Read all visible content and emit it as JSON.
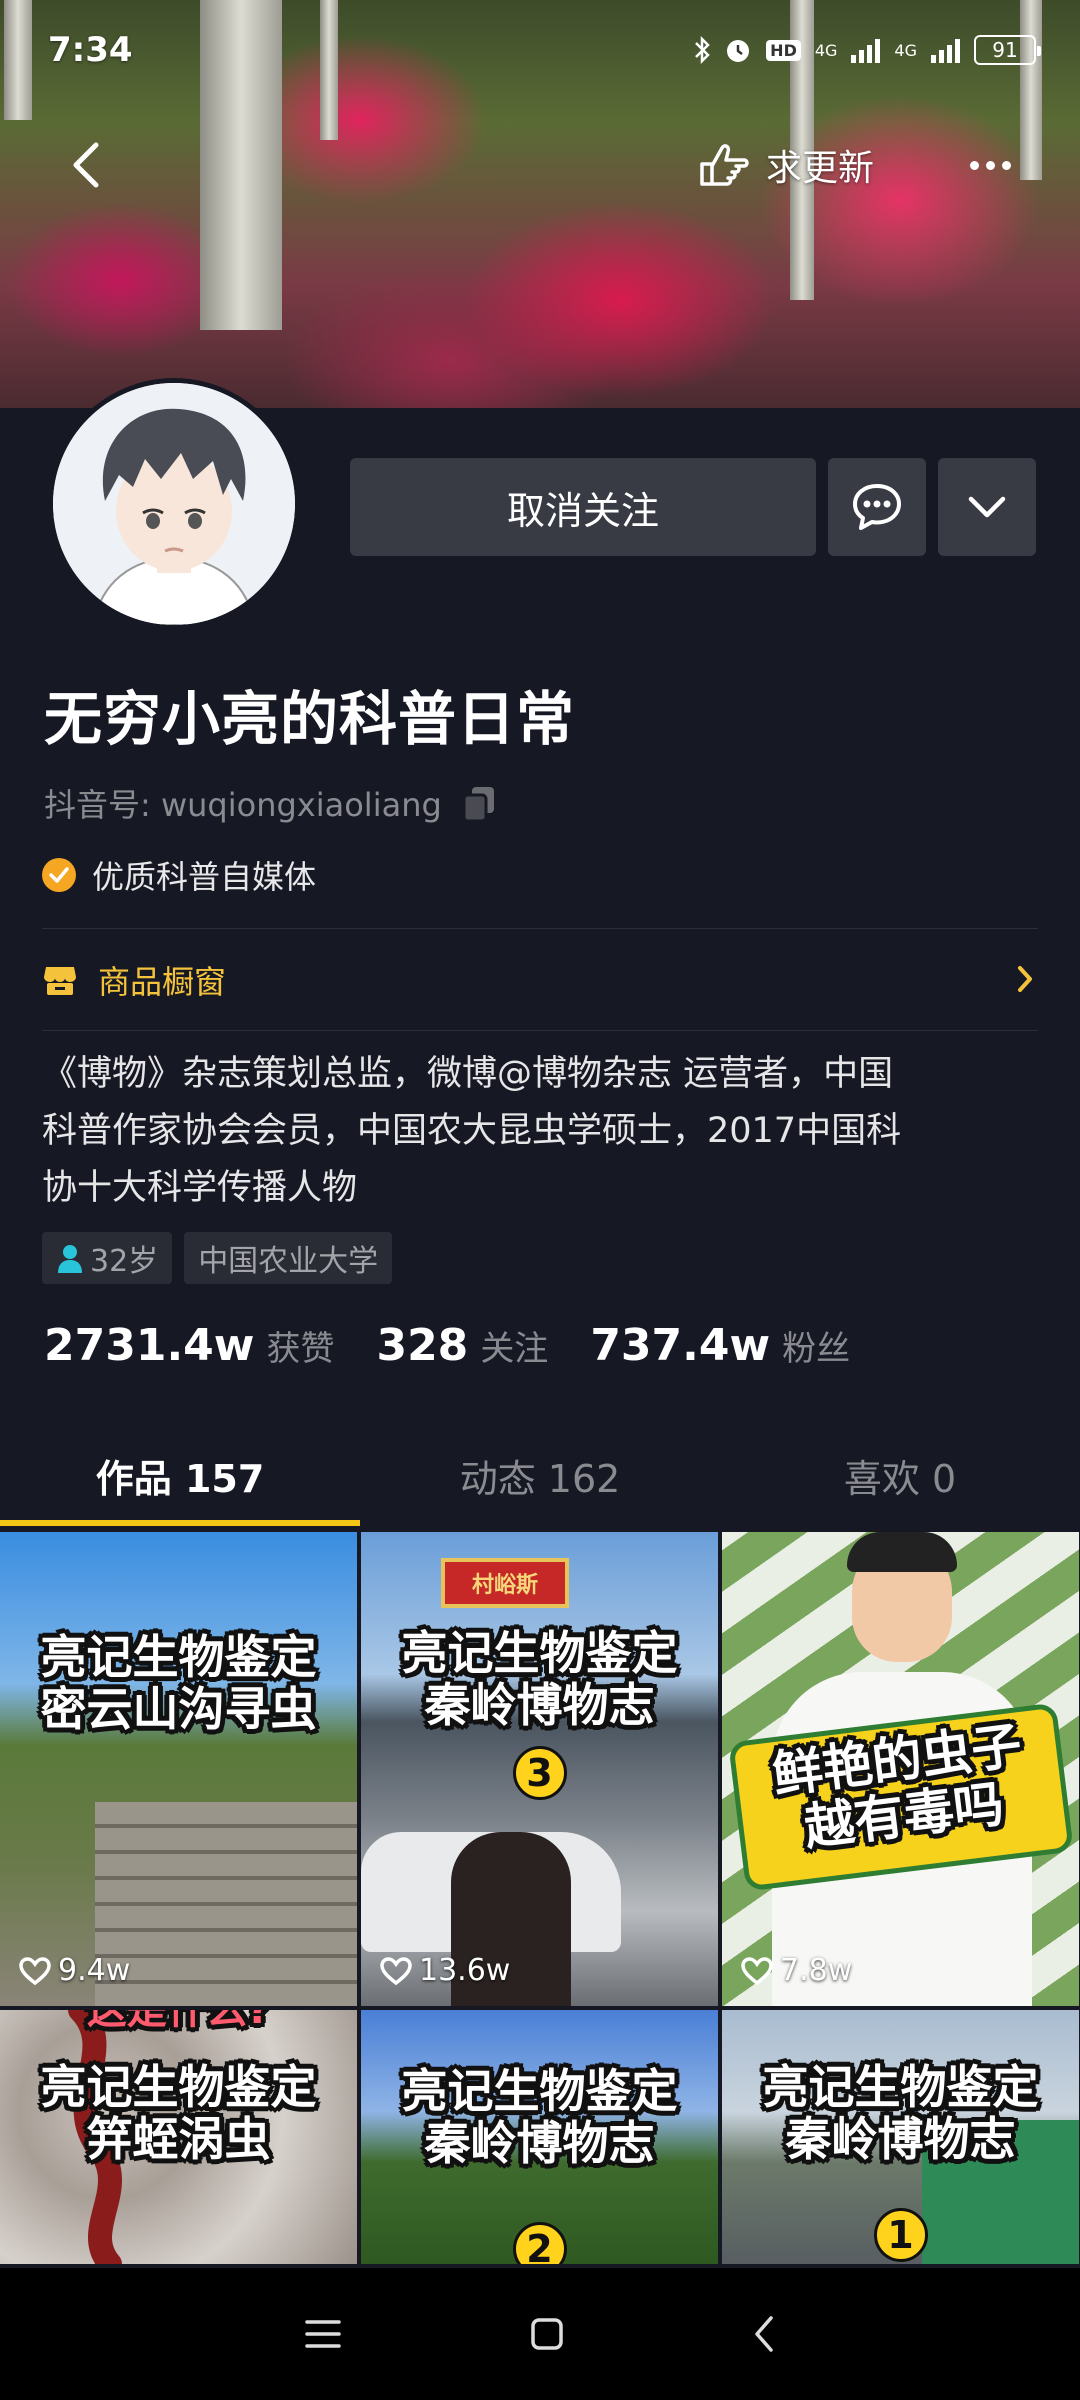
{
  "status_bar": {
    "time": "7:34",
    "battery": "91",
    "net1": "4G",
    "net2": "4G",
    "hd": "HD"
  },
  "top_nav": {
    "update_label": "求更新"
  },
  "profile": {
    "unfollow_label": "取消关注",
    "nickname": "无穷小亮的科普日常",
    "douyin_id": "抖音号: wuqiongxiaoliang",
    "verified_text": "优质科普自媒体",
    "shop_label": "商品橱窗",
    "bio_lines": [
      "《博物》杂志策划总监，微博@博物杂志 运营者，中国",
      "科普作家协会会员，中国农大昆虫学硕士，2017中国科",
      "协十大科学传播人物"
    ],
    "tags": {
      "age": "32岁",
      "school": "中国农业大学"
    }
  },
  "stats": [
    {
      "num": "2731.4w",
      "label": "获赞"
    },
    {
      "num": "328",
      "label": "关注"
    },
    {
      "num": "737.4w",
      "label": "粉丝"
    }
  ],
  "tabs": [
    {
      "label": "作品 157",
      "active": true
    },
    {
      "label": "动态 162",
      "active": false
    },
    {
      "label": "喜欢 0",
      "active": false
    }
  ],
  "videos": [
    {
      "line1": "亮记生物鉴定",
      "line2": "密云山沟寻虫",
      "likes": "9.4w"
    },
    {
      "line1": "亮记生物鉴定",
      "line2": "秦岭博物志",
      "badge": "3",
      "sign": "村峪斯",
      "likes": "13.6w"
    },
    {
      "line1": "鲜艳的虫子",
      "line2": "越有毒吗",
      "likes": "7.8w"
    },
    {
      "top_text": "这是什么?",
      "line1": "亮记生物鉴定",
      "line2": "笄蛭涡虫"
    },
    {
      "line1": "亮记生物鉴定",
      "line2": "秦岭博物志",
      "badge": "2"
    },
    {
      "line1": "亮记生物鉴定",
      "line2": "秦岭博物志",
      "badge": "1"
    }
  ],
  "icons": [
    "back-icon",
    "hand-pointer-icon",
    "more-icon",
    "chat-icon",
    "chevron-down-icon",
    "copy-icon",
    "verified-check-icon",
    "shop-icon",
    "chevron-right-icon",
    "person-icon",
    "heart-icon",
    "menu-icon",
    "home-square-icon",
    "nav-back-icon"
  ],
  "colors": {
    "background": "#161823",
    "button": "#393b44",
    "accent": "#f5c518",
    "shop": "#f5c33b",
    "verified": "#f5a623"
  }
}
